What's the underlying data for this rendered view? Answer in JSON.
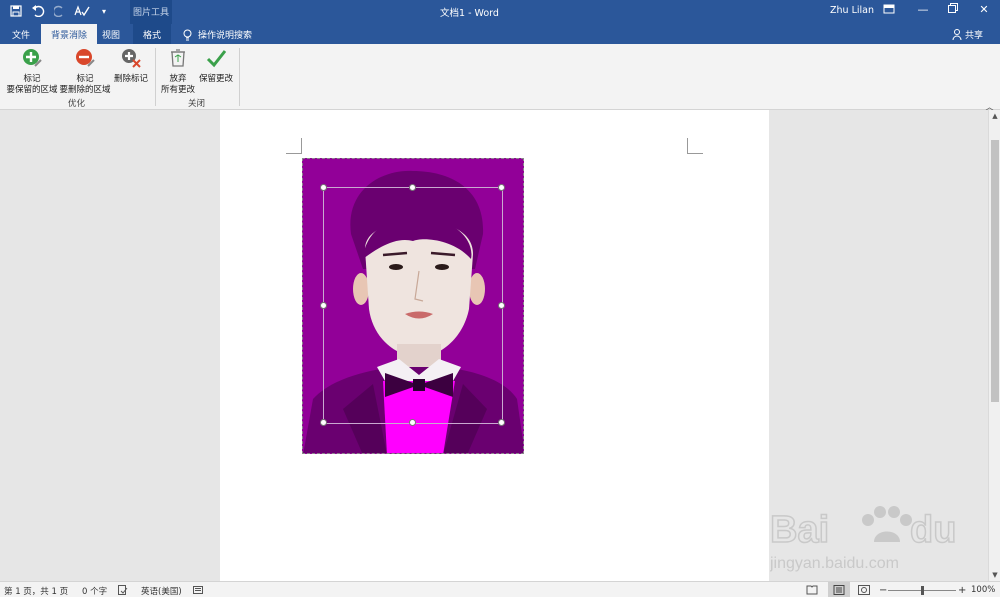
{
  "titlebar": {
    "context_group": "图片工具",
    "doc_title": "文档1  -  Word",
    "user": "Zhu Lilan"
  },
  "tabs": [
    {
      "label": "文件"
    },
    {
      "label": "背景消除"
    },
    {
      "label": "视图"
    },
    {
      "label": "格式"
    }
  ],
  "tell_me": "操作说明搜索",
  "share": "共享",
  "ribbon": {
    "mark_keep": {
      "line1": "标记",
      "line2": "要保留的区域"
    },
    "mark_remove": {
      "line1": "标记",
      "line2": "要删除的区域"
    },
    "delete_mark": {
      "label": "删除标记"
    },
    "group_refine": "优化",
    "discard": {
      "line1": "放弃",
      "line2": "所有更改"
    },
    "keep_changes": {
      "label": "保留更改"
    },
    "group_close": "关闭"
  },
  "status": {
    "page": "第 1 页，共 1 页",
    "words": "0 个字",
    "language": "英语(美国)",
    "zoom": "100%",
    "zoom_minus": "−",
    "zoom_plus": "+"
  },
  "colors": {
    "titlebar": "#2b579a",
    "photo_background": "#920098",
    "shirt": "#ff00ff"
  }
}
